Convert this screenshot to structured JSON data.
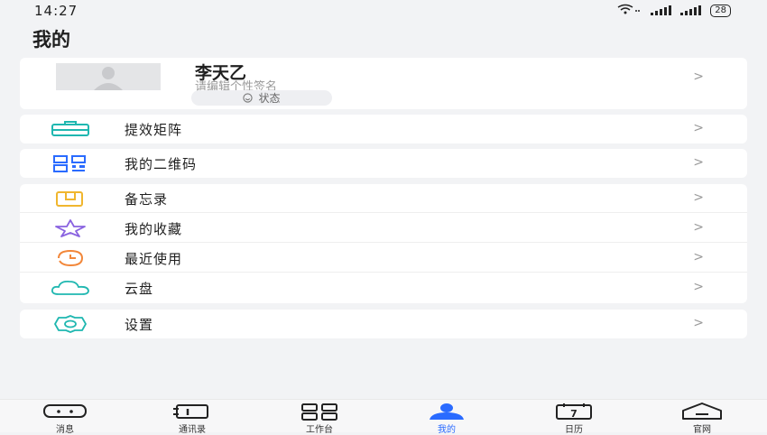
{
  "status_bar": {
    "time": "14:27",
    "battery": "28"
  },
  "header": {
    "title": "我的"
  },
  "profile": {
    "name": "李天乙",
    "signature_placeholder": "请编辑个性签名",
    "status_label": "状态"
  },
  "menu_groups": [
    [
      {
        "label": "提效矩阵",
        "icon": "toolbox-icon"
      }
    ],
    [
      {
        "label": "我的二维码",
        "icon": "qrcode-icon"
      }
    ],
    [
      {
        "label": "备忘录",
        "icon": "memo-icon"
      },
      {
        "label": "我的收藏",
        "icon": "star-icon"
      },
      {
        "label": "最近使用",
        "icon": "recent-icon"
      },
      {
        "label": "云盘",
        "icon": "cloud-icon"
      }
    ],
    [
      {
        "label": "设置",
        "icon": "gear-icon"
      }
    ]
  ],
  "chevron": ">",
  "tabs": [
    {
      "label": "消息",
      "icon": "message-icon"
    },
    {
      "label": "通讯录",
      "icon": "contacts-icon"
    },
    {
      "label": "工作台",
      "icon": "workbench-icon"
    },
    {
      "label": "我的",
      "icon": "profile-icon",
      "active": true
    },
    {
      "label": "日历",
      "icon": "calendar-icon",
      "day": "7"
    },
    {
      "label": "官网",
      "icon": "home-icon"
    }
  ],
  "colors": {
    "accent": "#2a6bff",
    "teal": "#1fb7b0",
    "yellow": "#f0b62e",
    "purple": "#8a63e0",
    "orange": "#f2873a"
  }
}
